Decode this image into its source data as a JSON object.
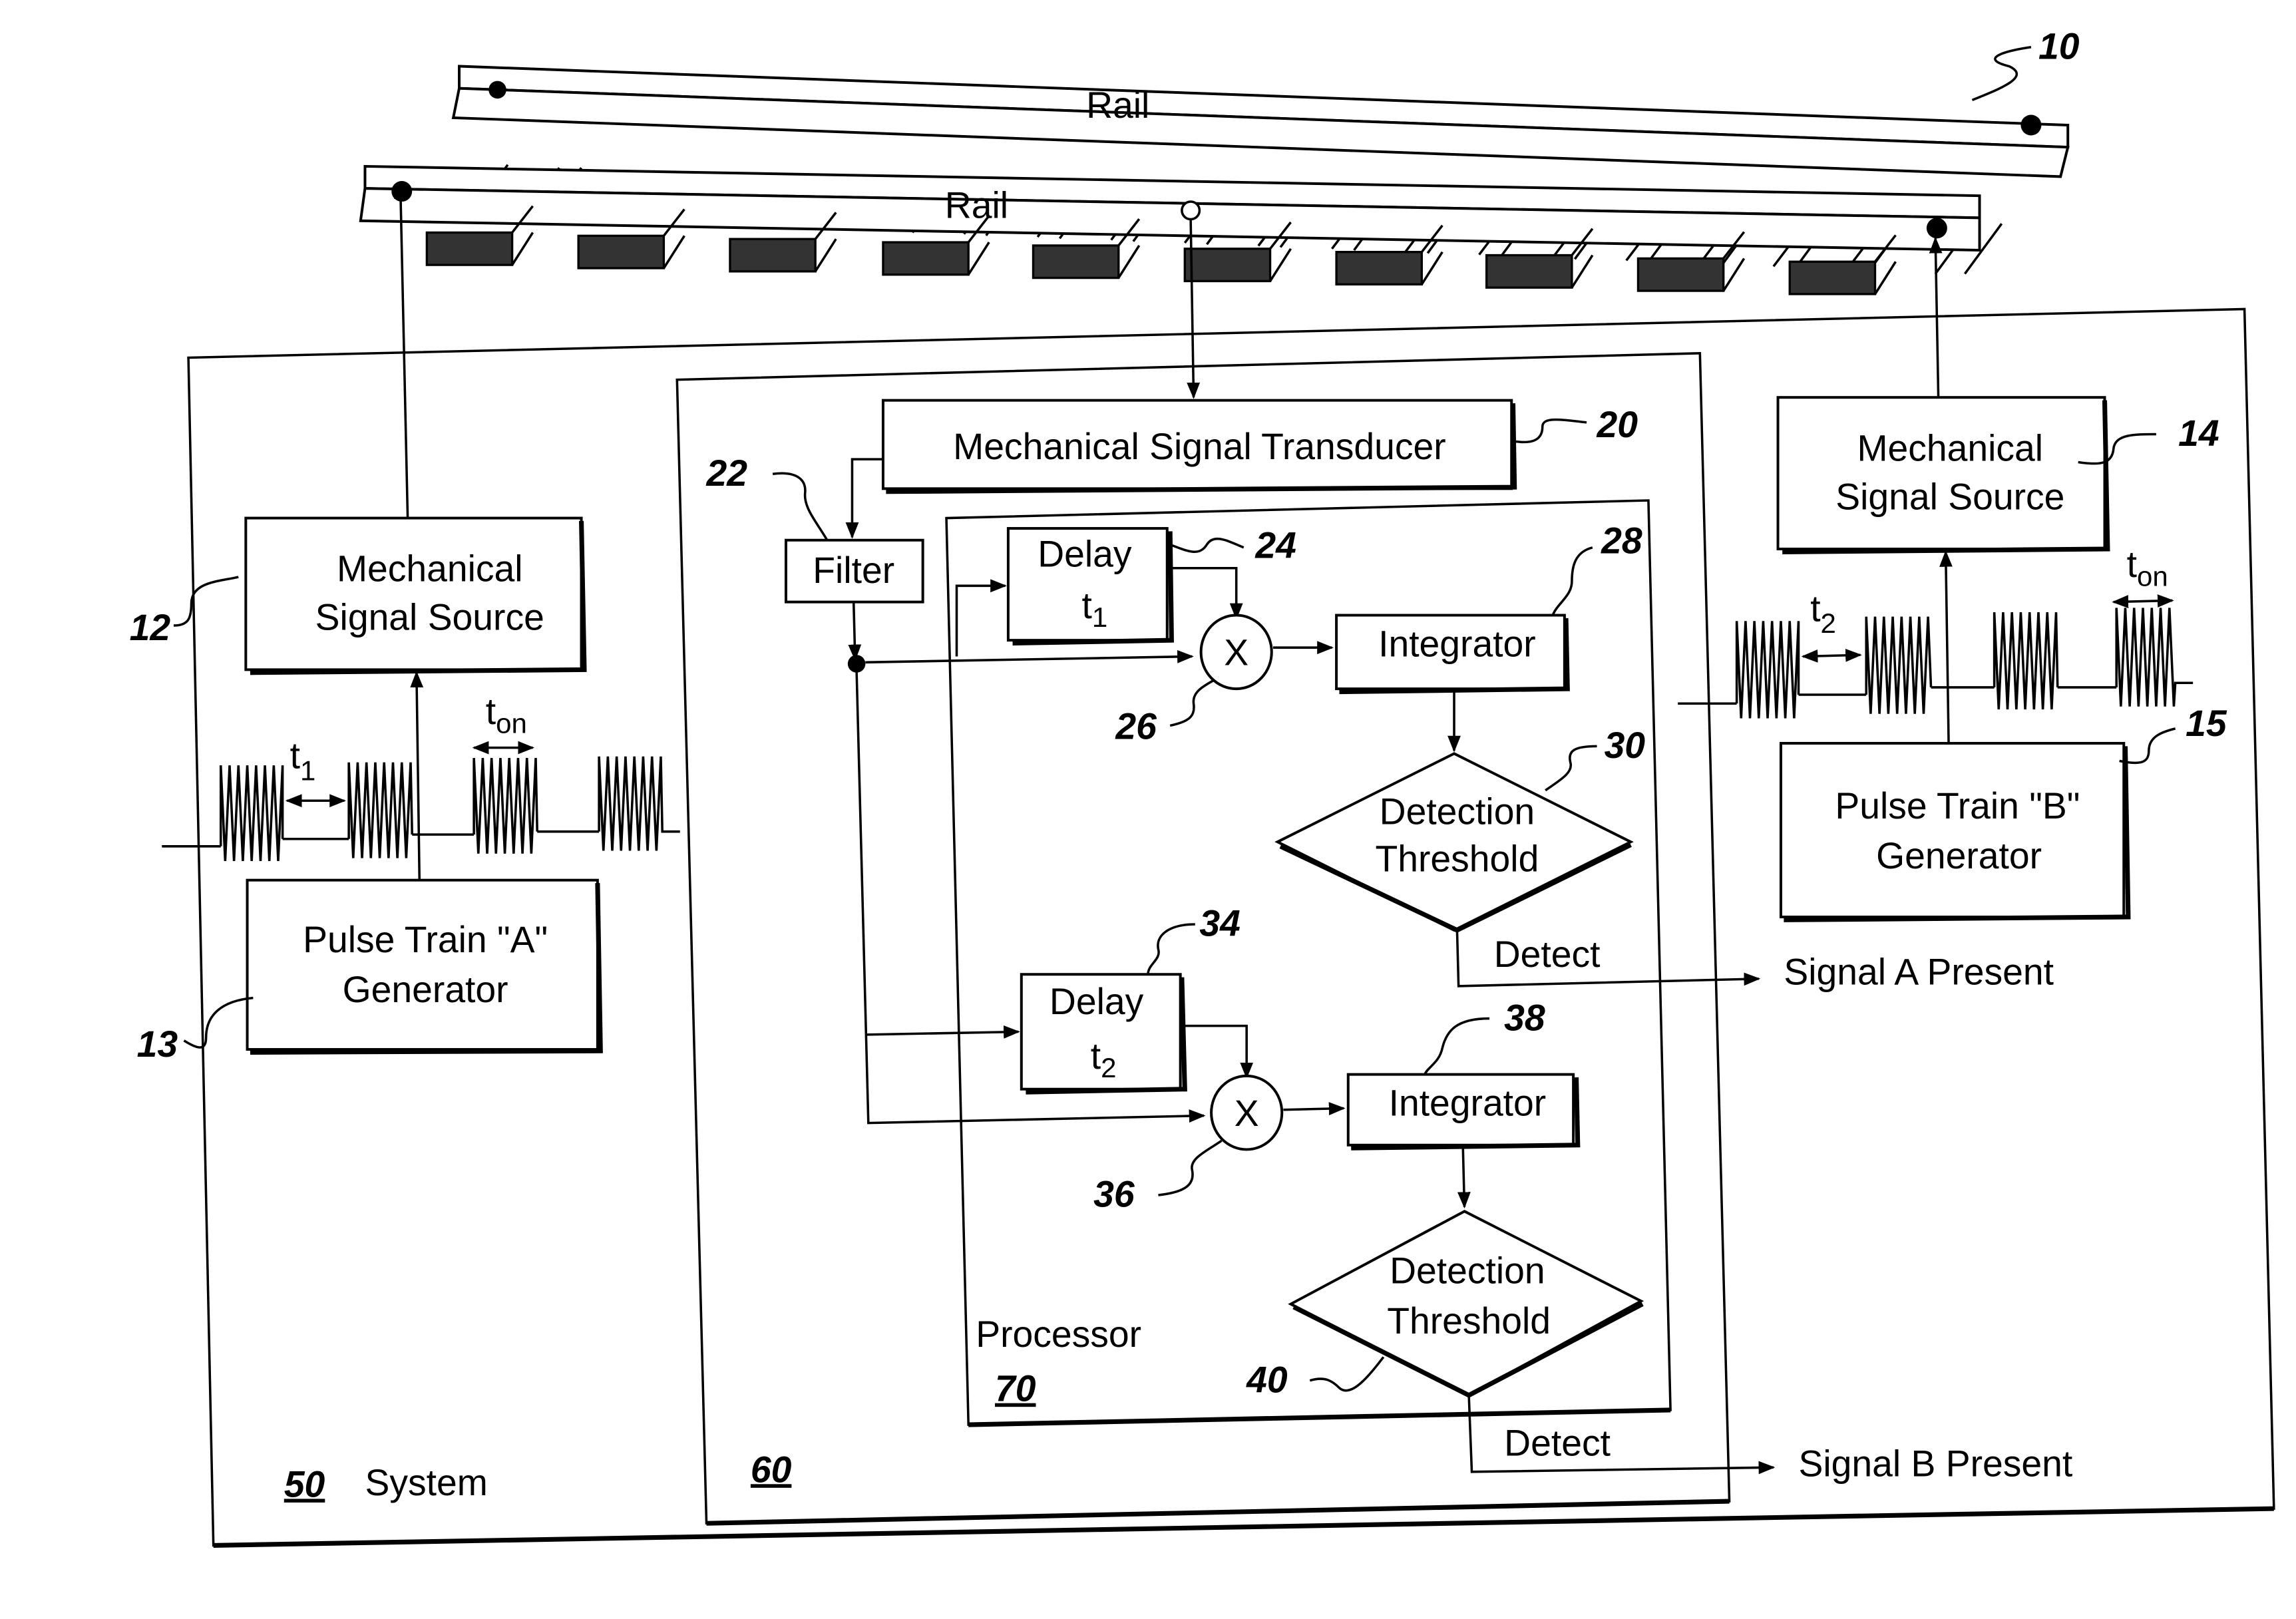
{
  "figure": {
    "rails": [
      {
        "label": "Rail",
        "ref": "10"
      },
      {
        "label": "Rail"
      }
    ],
    "system": {
      "ref": "50",
      "label": "System"
    },
    "unit": {
      "ref": "60"
    },
    "processor": {
      "ref": "70",
      "label": "Processor"
    },
    "left_source": {
      "source": {
        "ref": "12",
        "line1": "Mechanical",
        "line2": "Signal Source"
      },
      "generator": {
        "ref": "13",
        "line1": "Pulse Train \"A\"",
        "line2": "Generator"
      },
      "interval_label": "t",
      "interval_sub": "1",
      "on_label": "t",
      "on_sub": "on"
    },
    "right_source": {
      "source": {
        "ref": "14",
        "line1": "Mechanical",
        "line2": "Signal Source"
      },
      "generator": {
        "ref": "15",
        "line1": "Pulse Train \"B\"",
        "line2": "Generator"
      },
      "interval_label": "t",
      "interval_sub": "2",
      "on_label": "t",
      "on_sub": "on"
    },
    "transducer": {
      "ref": "20",
      "label": "Mechanical Signal Transducer"
    },
    "filter": {
      "ref": "22",
      "label": "Filter"
    },
    "channel_a": {
      "delay": {
        "ref": "24",
        "line1": "Delay",
        "t": "t",
        "sub": "1"
      },
      "multiplier": {
        "ref": "26",
        "symbol": "X"
      },
      "integrator": {
        "ref": "28",
        "label": "Integrator"
      },
      "threshold": {
        "ref": "30",
        "line1": "Detection",
        "line2": "Threshold"
      },
      "detect_label": "Detect",
      "output": "Signal A Present"
    },
    "channel_b": {
      "delay": {
        "ref": "34",
        "line1": "Delay",
        "t": "t",
        "sub": "2"
      },
      "multiplier": {
        "ref": "36",
        "symbol": "X"
      },
      "integrator": {
        "ref": "38",
        "label": "Integrator"
      },
      "threshold": {
        "ref": "40",
        "line1": "Detection",
        "line2": "Threshold"
      },
      "detect_label": "Detect",
      "output": "Signal B Present"
    }
  }
}
